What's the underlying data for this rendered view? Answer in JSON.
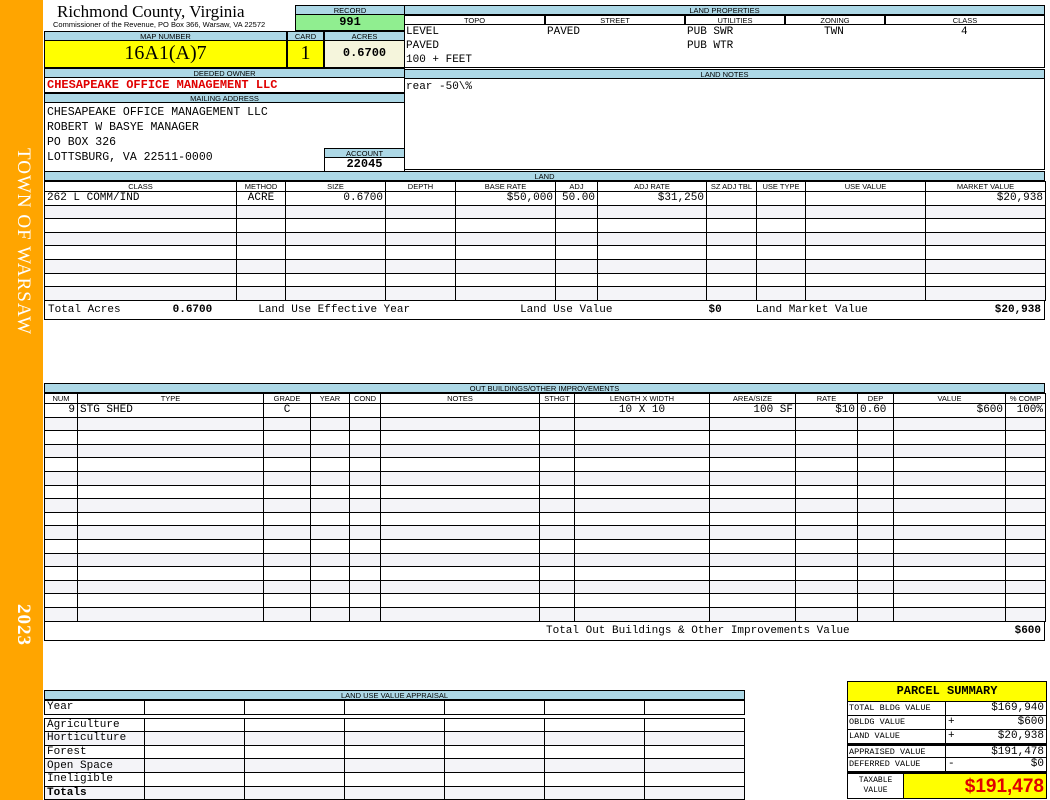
{
  "sidebar": {
    "town": "TOWN OF WARSAW",
    "year": "2023"
  },
  "header": {
    "county": "Richmond County, Virginia",
    "subtitle": "Commissioner of the Revenue, PO Box 366, Warsaw, VA 22572"
  },
  "record": {
    "label": "RECORD",
    "value": "991"
  },
  "map": {
    "label": "MAP NUMBER",
    "value": "16A1(A)7",
    "card_label": "CARD",
    "card": "1",
    "acres_label": "ACRES",
    "acres": "0.6700"
  },
  "owner": {
    "label": "DEEDED OWNER",
    "value": "CHESAPEAKE OFFICE MANAGEMENT LLC"
  },
  "mailing": {
    "label": "MAILING ADDRESS",
    "lines": [
      "CHESAPEAKE OFFICE MANAGEMENT LLC",
      "ROBERT W BASYE MANAGER",
      "PO BOX 326",
      "LOTTSBURG, VA 22511-0000"
    ]
  },
  "account": {
    "label": "ACCOUNT",
    "value": "22045"
  },
  "land_properties": {
    "label": "LAND PROPERTIES",
    "columns": [
      "TOPO",
      "STREET",
      "UTILITIES",
      "ZONING",
      "CLASS"
    ],
    "topo": [
      "LEVEL",
      "PAVED",
      "100 + FEET"
    ],
    "street": "PAVED",
    "utilities": [
      "PUB SWR",
      "PUB WTR"
    ],
    "zoning": "TWN",
    "class": "4"
  },
  "land_notes": {
    "label": "LAND NOTES",
    "text": "rear -50\\%"
  },
  "land": {
    "label": "LAND",
    "columns": [
      "CLASS",
      "METHOD",
      "SIZE",
      "DEPTH",
      "BASE RATE",
      "ADJ",
      "ADJ RATE",
      "SZ ADJ TBL",
      "USE TYPE",
      "USE VALUE",
      "MARKET VALUE"
    ],
    "rows": [
      [
        "262 L COMM/IND",
        "ACRE",
        "0.6700",
        "",
        "$50,000",
        "50.00",
        "$31,250",
        "",
        "",
        "",
        "$20,938"
      ]
    ],
    "total_acres_label": "Total Acres",
    "total_acres": "0.6700",
    "effective_year_label": "Land Use Effective Year",
    "use_value_label": "Land Use Value",
    "use_value": "$0",
    "market_value_label": "Land Market Value",
    "market_value": "$20,938"
  },
  "outbuildings": {
    "label": "OUT BUILDINGS/OTHER IMPROVEMENTS",
    "columns": [
      "NUM",
      "TYPE",
      "GRADE",
      "YEAR",
      "COND",
      "NOTES",
      "STHGT",
      "LENGTH X WIDTH",
      "AREA/SIZE",
      "RATE",
      "DEP",
      "VALUE",
      "% COMP"
    ],
    "rows": [
      [
        "9",
        "STG SHED",
        "C",
        "",
        "",
        "",
        "",
        "10 X 10",
        "100 SF",
        "$10",
        "0.60",
        "$600",
        "100%"
      ]
    ],
    "total_label": "Total Out Buildings & Other Improvements Value",
    "total": "$600"
  },
  "land_use": {
    "label": "LAND USE VALUE APPRAISAL",
    "year_label": "Year",
    "rows": [
      "Agriculture",
      "Horticulture",
      "Forest",
      "Open Space",
      "Ineligible"
    ],
    "totals_label": "Totals"
  },
  "summary": {
    "title": "PARCEL SUMMARY",
    "rows": [
      {
        "label": "TOTAL BLDG VALUE",
        "op": "",
        "value": "$169,940"
      },
      {
        "label": "OBLDG VALUE",
        "op": "+",
        "value": "$600"
      },
      {
        "label": "LAND VALUE",
        "op": "+",
        "value": "$20,938"
      },
      {
        "label": "APPRAISED VALUE",
        "op": "",
        "value": "$191,478"
      },
      {
        "label": "DEFERRED VALUE",
        "op": "-",
        "value": "$0"
      }
    ],
    "taxable_label": "TAXABLE VALUE",
    "taxable": "$191,478"
  },
  "colors": {
    "sidebar": "#ffa500",
    "header_blue": "#add8e6",
    "record_green": "#90ee90",
    "highlight_yellow": "#ffff00",
    "owner_red": "#e00000"
  }
}
